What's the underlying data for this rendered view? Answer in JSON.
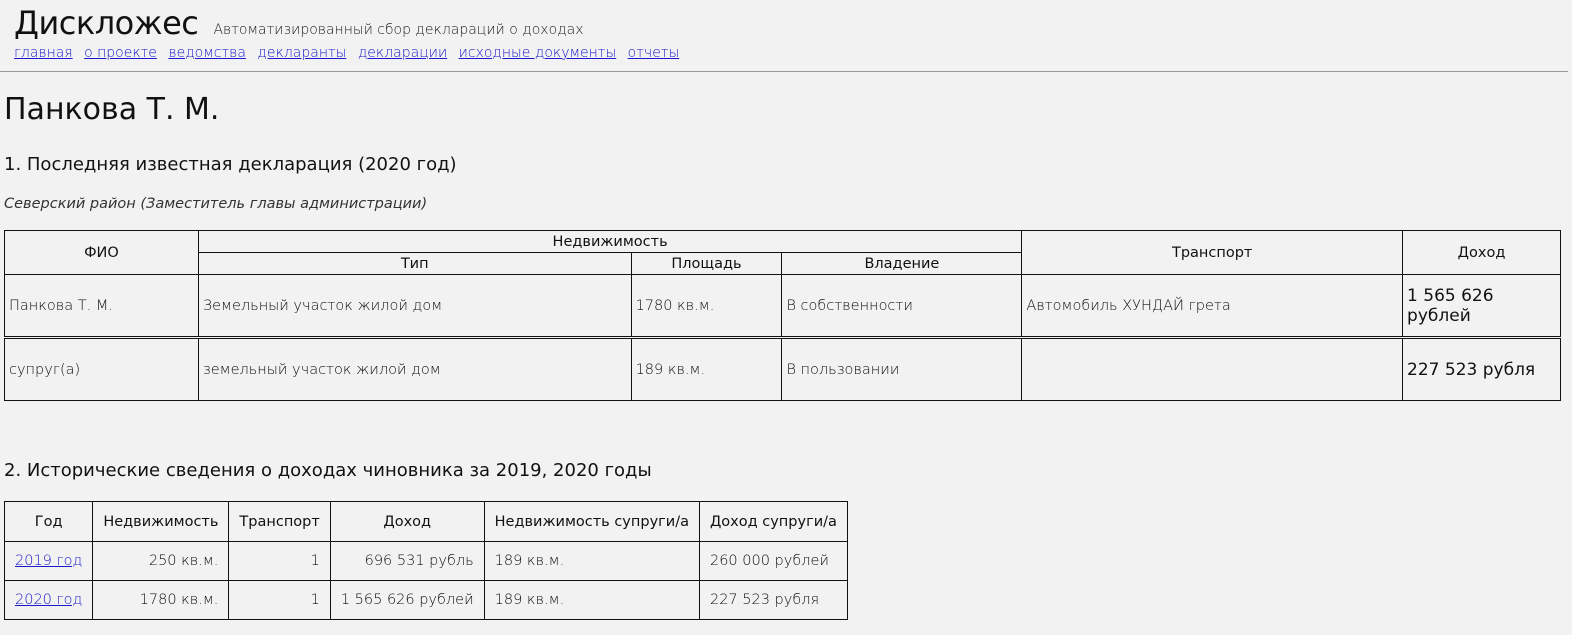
{
  "site": {
    "brand": "Дискложес",
    "tagline": "Автоматизированный сбор деклараций о доходах",
    "nav": [
      "главная",
      "о проекте",
      "ведомства",
      "декларанты",
      "декларации",
      "исходные документы",
      "отчеты"
    ]
  },
  "person": {
    "name": "Панкова Т. М."
  },
  "section1": {
    "title": "1. Последняя известная декларация (2020 год)",
    "department": "Северский район (Заместитель главы администрации)",
    "headers": {
      "fio": "ФИО",
      "realty": "Недвижимость",
      "type": "Тип",
      "area": "Площадь",
      "ownership": "Владение",
      "transport": "Транспорт",
      "income": "Доход"
    },
    "rows": [
      {
        "fio": "Панкова Т. М.",
        "type": "Земельный участок жилой дом",
        "area": "1780 кв.м.",
        "ownership": "В собственности",
        "transport": "Автомобиль ХУНДАЙ грета",
        "income": "1 565 626 рублей"
      },
      {
        "fio": "супруг(а)",
        "type": "земельный участок жилой дом",
        "area": "189 кв.м.",
        "ownership": "В пользовании",
        "transport": "",
        "income": "227 523 рубля"
      }
    ]
  },
  "section2": {
    "title": "2. Исторические сведения о доходах чиновника за 2019, 2020 годы",
    "headers": [
      "Год",
      "Недвижимость",
      "Транспорт",
      "Доход",
      "Недвижимость супруги/а",
      "Доход супруги/а"
    ],
    "rows": [
      {
        "year": "2019 год",
        "realty": "250 кв.м.",
        "transport": "1",
        "income": "696 531 рубль",
        "spouse_realty": "189 кв.м.",
        "spouse_income": "260 000 рублей"
      },
      {
        "year": "2020 год",
        "realty": "1780 кв.м.",
        "transport": "1",
        "income": "1 565 626 рублей",
        "spouse_realty": "189 кв.м.",
        "spouse_income": "227 523 рубля"
      }
    ]
  }
}
